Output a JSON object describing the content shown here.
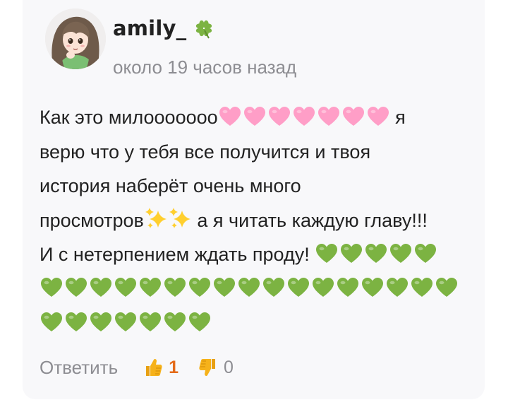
{
  "comment": {
    "author": {
      "username": "amily_",
      "badge_icon": "four-leaf-clover-icon",
      "avatar_icon": "anime-girl-avatar"
    },
    "timestamp": "около 19 часов назад",
    "text": {
      "line1_a": "Как это милооооооо",
      "line1_b": "я",
      "line2": "верю что у тебя все получится и твоя",
      "line3": "история наберёт очень много",
      "line4_a": "просмотров",
      "line4_b": "а я читать каждую главу!!!",
      "line5": "И с нетерпением ждать проду!"
    },
    "emoji": {
      "pink_heart_count": 7,
      "green_heart_counts": [
        5,
        17,
        7
      ],
      "sparkles_count": 2,
      "pink_heart_color": "#ff9ec7",
      "green_heart_color": "#7cb342"
    },
    "actions": {
      "reply_label": "Ответить",
      "like_count": "1",
      "dislike_count": "0",
      "like_color": "#e46b1a",
      "thumb_color": "#f6b21a"
    }
  }
}
